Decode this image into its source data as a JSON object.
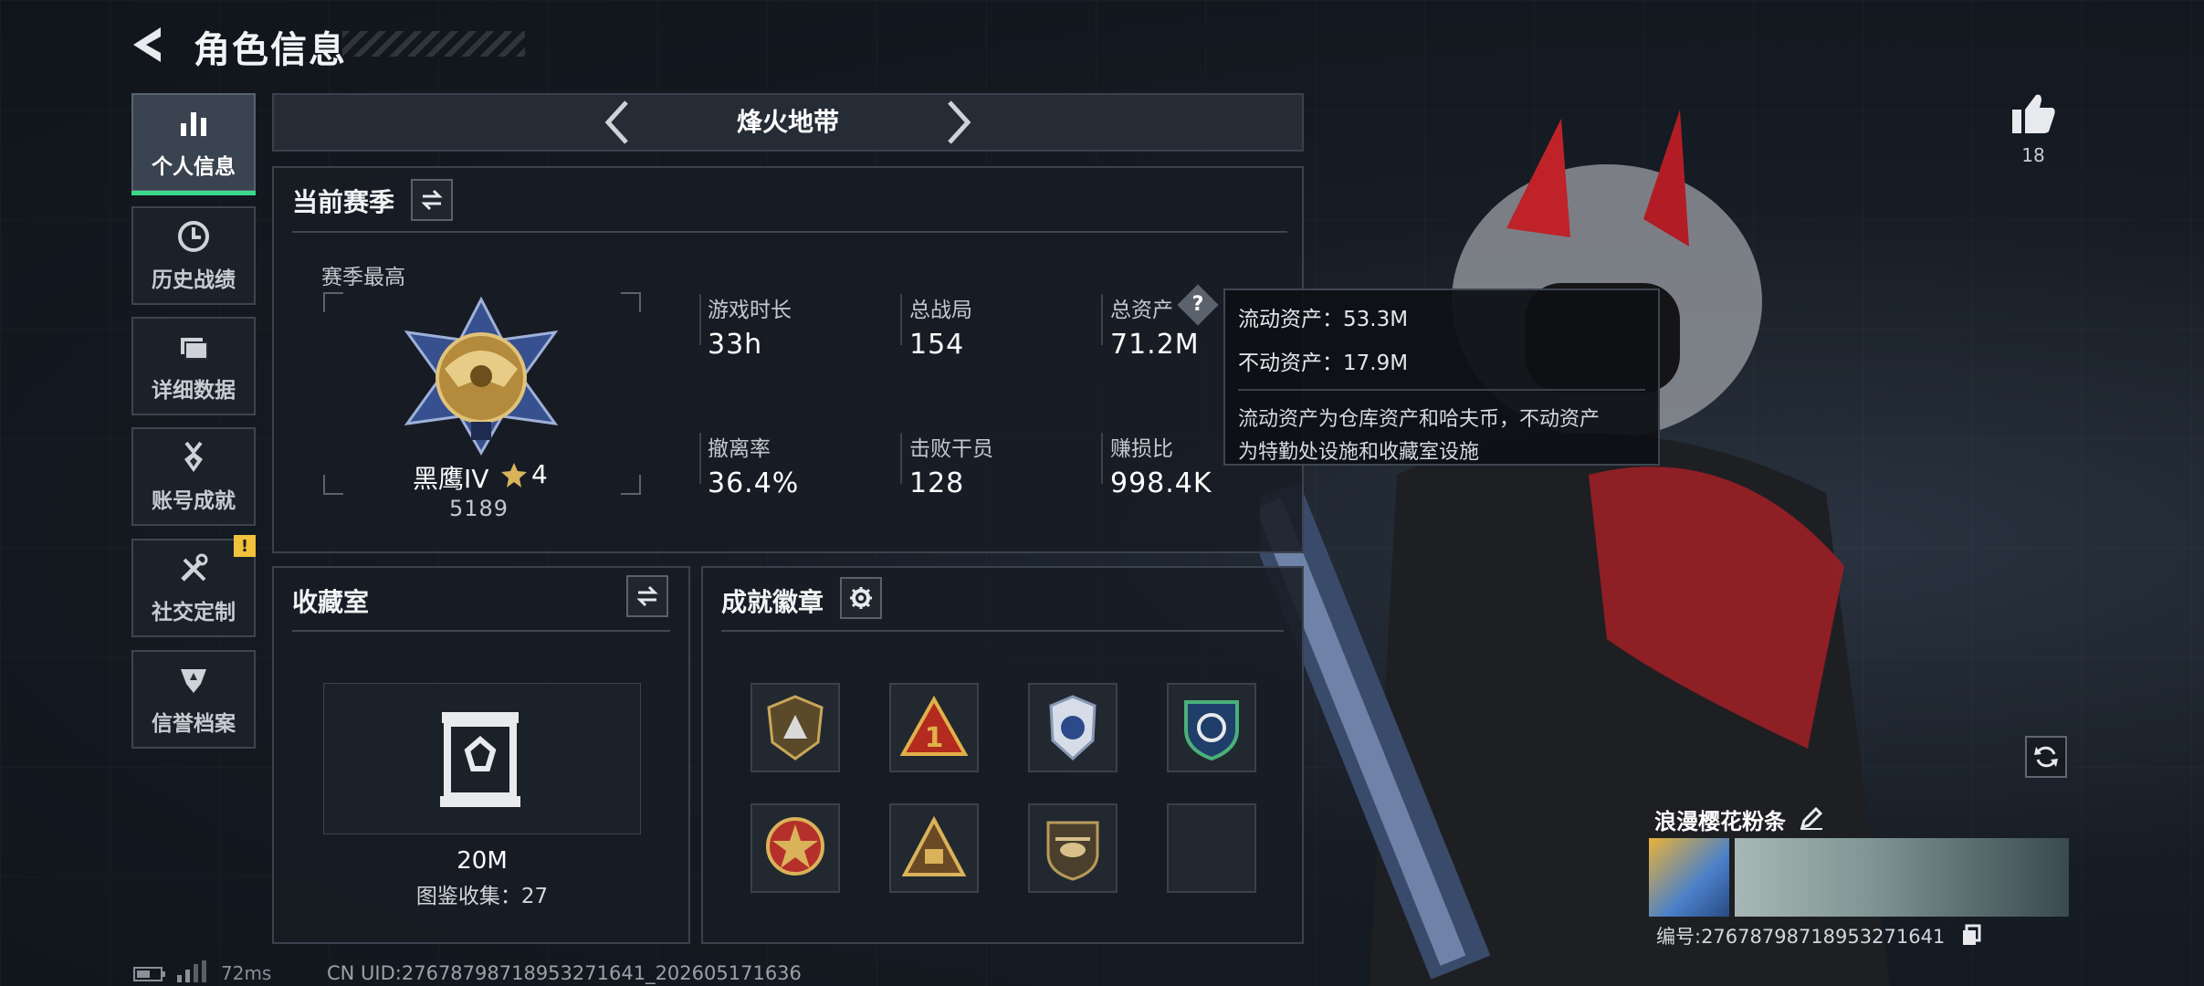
{
  "header": {
    "title": "角色信息"
  },
  "nav": {
    "items": [
      {
        "label": "个人信息",
        "icon": "bar-chart-icon",
        "active": true
      },
      {
        "label": "历史战绩",
        "icon": "clock-icon",
        "active": false
      },
      {
        "label": "详细数据",
        "icon": "folder-icon",
        "active": false
      },
      {
        "label": "账号成就",
        "icon": "medal-icon",
        "active": false
      },
      {
        "label": "社交定制",
        "icon": "tools-icon",
        "active": false,
        "alert": "!"
      },
      {
        "label": "信誉档案",
        "icon": "shield-icon",
        "active": false
      }
    ]
  },
  "mode_selector": {
    "title": "烽火地带"
  },
  "season": {
    "title": "当前赛季",
    "best_label": "赛季最高",
    "rank_name": "黑鹰IV",
    "rank_stars": "4",
    "rank_points": "5189",
    "stats": [
      {
        "label": "游戏时长",
        "value": "33h"
      },
      {
        "label": "总战局",
        "value": "154"
      },
      {
        "label": "总资产",
        "value": "71.2M"
      },
      {
        "label": "撤离率",
        "value": "36.4%"
      },
      {
        "label": "击败干员",
        "value": "128"
      },
      {
        "label": "赚损比",
        "value": "998.4K"
      }
    ]
  },
  "tooltip": {
    "liquid": "流动资产：53.3M",
    "fixed": "不动资产：17.9M",
    "desc_line1": "流动资产为仓库资产和哈夫币，不动资产",
    "desc_line2": "为特勤处设施和收藏室设施"
  },
  "collection": {
    "title": "收藏室",
    "value": "20M",
    "count_text": "图鉴收集：27"
  },
  "achievements": {
    "title": "成就徽章",
    "badges": [
      "badge-1",
      "badge-2",
      "badge-3",
      "badge-4",
      "badge-5",
      "badge-6",
      "badge-7",
      "empty"
    ]
  },
  "profile": {
    "likes": "18",
    "name": "浪漫樱花粉条",
    "id_text": "编号:276787987189532716​41"
  },
  "status": {
    "ping": "72ms",
    "uid": "CN UID:276787987189532716​41_202605171636"
  },
  "colors": {
    "accent_green": "#3bd88c",
    "alert_yellow": "#f2c23a"
  }
}
